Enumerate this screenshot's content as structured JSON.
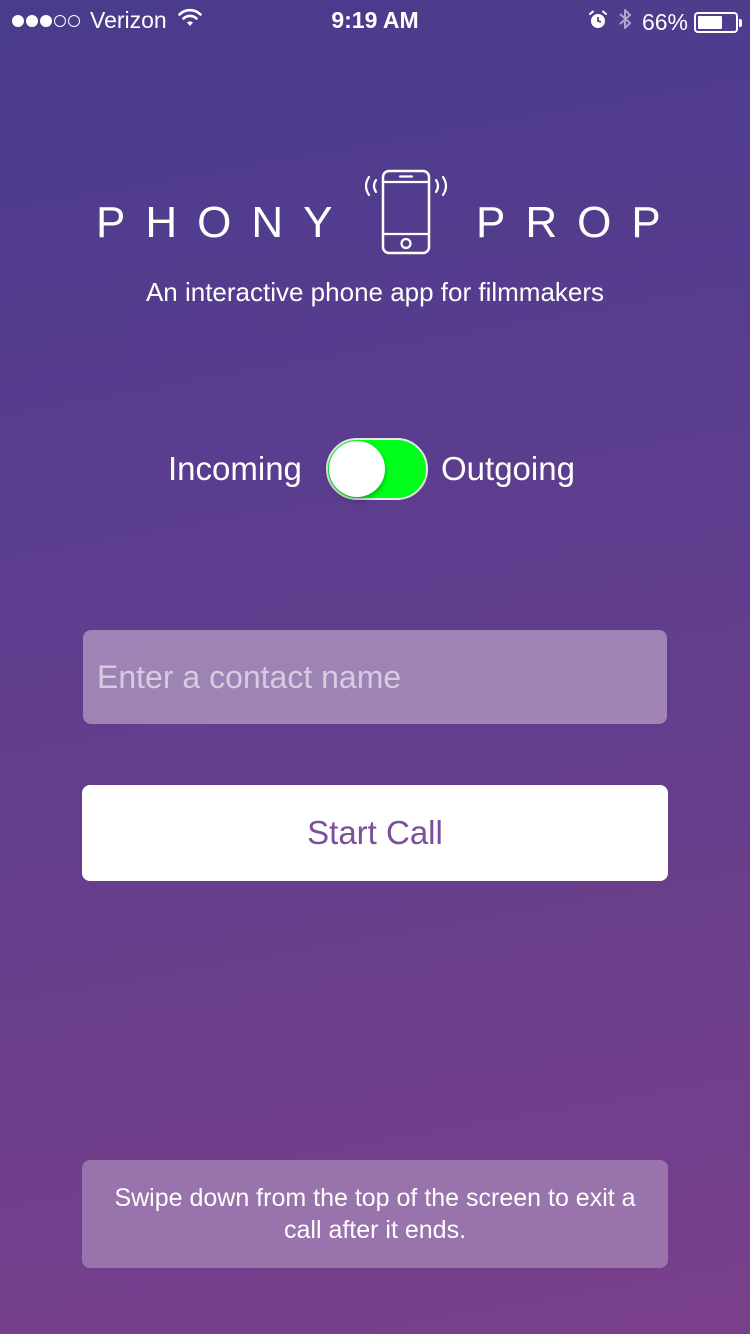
{
  "status_bar": {
    "signal_dots_filled": 3,
    "signal_dots_total": 5,
    "carrier": "Verizon",
    "time": "9:19 AM",
    "battery_percent": "66%",
    "battery_level": 0.66,
    "icons": [
      "wifi-icon",
      "alarm-icon",
      "bluetooth-icon",
      "battery-icon"
    ]
  },
  "logo": {
    "left_text": "PHONY",
    "right_text": "PROP",
    "icon": "phone-vibrating-icon"
  },
  "tagline": "An interactive phone app for filmmakers",
  "call_direction": {
    "left_label": "Incoming",
    "right_label": "Outgoing",
    "selected": "Outgoing",
    "on_color": "#00ff1a"
  },
  "contact_input": {
    "value": "",
    "placeholder": "Enter a contact name"
  },
  "start_call": {
    "label": "Start Call",
    "text_color": "#7b4f9a"
  },
  "hint": "Swipe down from the top of the screen to exit a call after it ends."
}
